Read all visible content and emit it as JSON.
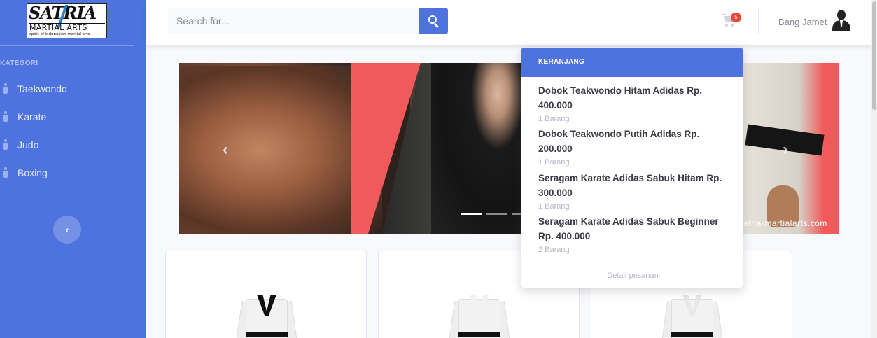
{
  "brand": {
    "name_top": "SATRIA",
    "name_mid": "MARTIAL ARTS",
    "tagline": "spirit of indonesian martial arts"
  },
  "sidebar": {
    "heading": "KATEGORI",
    "items": [
      {
        "label": "Taekwondo"
      },
      {
        "label": "Karate"
      },
      {
        "label": "Judo"
      },
      {
        "label": "Boxing"
      }
    ],
    "toggle_icon": "‹"
  },
  "topbar": {
    "search_placeholder": "Search for...",
    "cart_count": "5",
    "username": "Bang Jamet"
  },
  "carousel": {
    "watermark": "atria-martialarts.com",
    "prev_icon": "‹",
    "next_icon": "›",
    "active_index": 0
  },
  "cart_dropdown": {
    "header": "KERANJANG",
    "items": [
      {
        "title": "Dobok Teakwondo Hitam Adidas Rp. 400.000",
        "qty": "1 Barang"
      },
      {
        "title": "Dobok Teakwondo Putih Adidas Rp. 200.000",
        "qty": "1 Barang"
      },
      {
        "title": "Seragam Karate Adidas Sabuk Hitam Rp. 300.000",
        "qty": "1 Barang"
      },
      {
        "title": "Seragam Karate Adidas Sabuk Beginner Rp. 400.000",
        "qty": "2 Barang"
      }
    ],
    "footer": "Detail pesanan"
  },
  "colors": {
    "primary": "#4e73df",
    "badge": "#e74a3b"
  }
}
